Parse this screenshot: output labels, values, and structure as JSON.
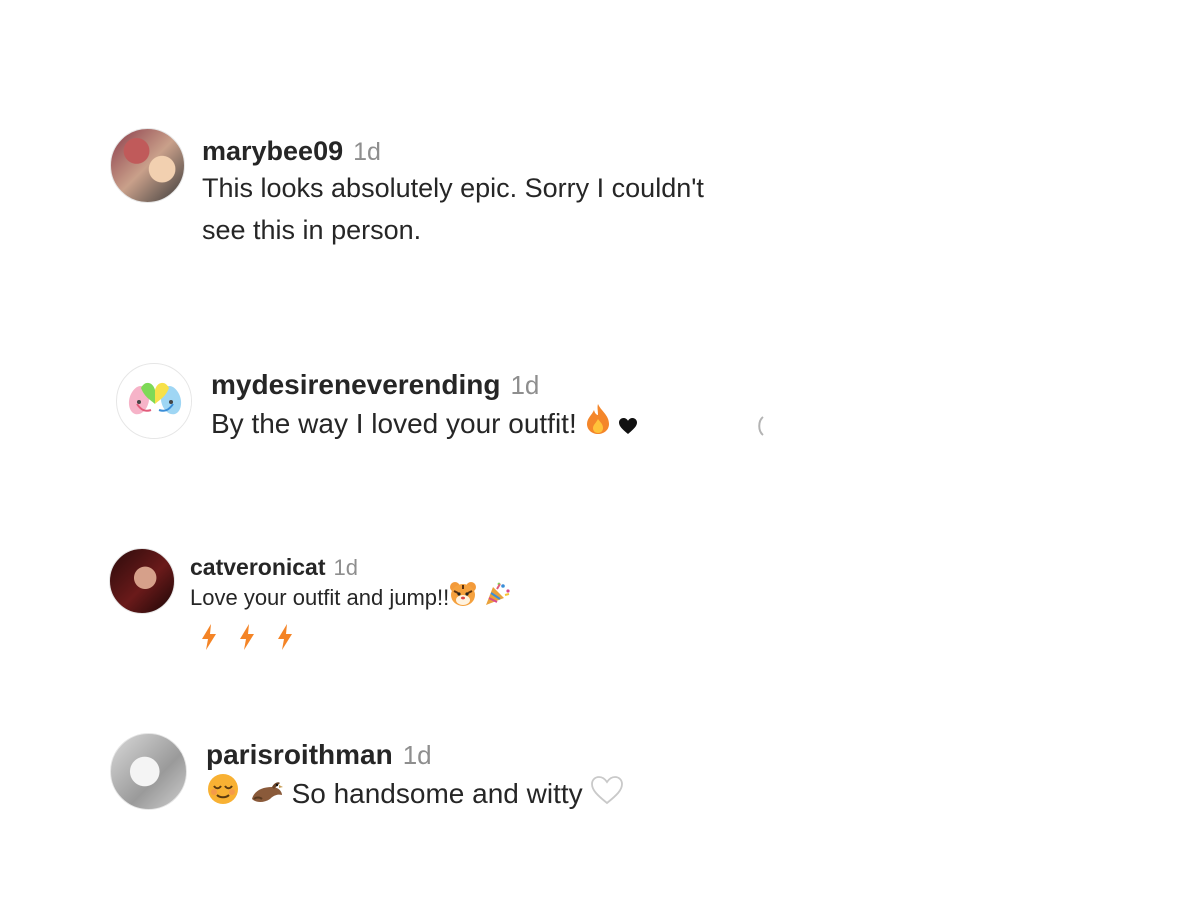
{
  "comments": [
    {
      "username": "marybee09",
      "time": "1d",
      "text": "This looks absolutely epic. Sorry I couldn't see this in person."
    },
    {
      "username": "mydesireneverending",
      "time": "1d",
      "text": "By the way I loved your outfit!"
    },
    {
      "username": "catveronicat",
      "time": "1d",
      "text": "Love your outfit and jump!!"
    },
    {
      "username": "parisroithman",
      "time": "1d",
      "text": "So handsome and witty"
    }
  ],
  "icons": {
    "fire": "fire-emoji-icon",
    "heart_black": "black-heart-icon",
    "tiger": "tiger-face-emoji-icon",
    "party": "party-popper-emoji-icon",
    "lightning": "lightning-emoji-icon",
    "relieved": "relieved-face-emoji-icon",
    "dodo": "dodo-bird-emoji-icon",
    "heart_white": "white-heart-icon",
    "truncated": "truncated-icon"
  },
  "colors": {
    "text": "#262626",
    "muted": "#8e8e8e",
    "fire": "#f4862a",
    "lightning": "#f48426"
  }
}
